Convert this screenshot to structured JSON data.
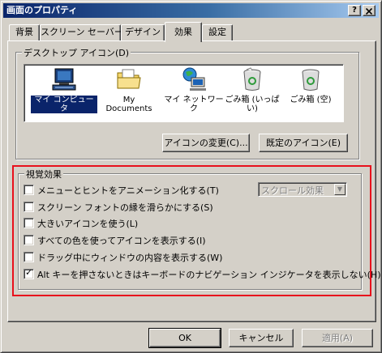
{
  "window": {
    "title": "画面のプロパティ",
    "help_button": "?",
    "close_button": "x"
  },
  "tabs": [
    {
      "label": "背景",
      "active": false
    },
    {
      "label": "スクリーン セーバー",
      "active": false
    },
    {
      "label": "デザイン",
      "active": false
    },
    {
      "label": "効果",
      "active": true
    },
    {
      "label": "設定",
      "active": false
    }
  ],
  "desktop_icons": {
    "group_label": "デスクトップ アイコン(D)",
    "items": [
      {
        "label": "マイ コンピュータ",
        "icon": "my-computer-icon",
        "selected": true
      },
      {
        "label": "My Documents",
        "icon": "my-documents-folder-icon",
        "selected": false
      },
      {
        "label": "マイ ネットワーク",
        "icon": "my-network-icon",
        "selected": false
      },
      {
        "label": "ごみ箱 (いっぱい)",
        "icon": "recycle-bin-full-icon",
        "selected": false
      },
      {
        "label": "ごみ箱 (空)",
        "icon": "recycle-bin-empty-icon",
        "selected": false
      }
    ],
    "change_icon_button": "アイコンの変更(C)...",
    "default_icon_button": "既定のアイコン(E)"
  },
  "visual_effects": {
    "group_label": "視覚効果",
    "options": [
      {
        "label": "メニューとヒントをアニメーション化する(T)",
        "checked": false
      },
      {
        "label": "スクリーン フォントの縁を滑らかにする(S)",
        "checked": false
      },
      {
        "label": "大きいアイコンを使う(L)",
        "checked": false
      },
      {
        "label": "すべての色を使ってアイコンを表示する(I)",
        "checked": false
      },
      {
        "label": "ドラッグ中にウィンドウの内容を表示する(W)",
        "checked": false
      },
      {
        "label": "Alt キーを押さないときはキーボードのナビゲーション インジケータを表示しない(H)",
        "checked": true
      }
    ],
    "effect_select": {
      "value": "スクロール効果",
      "disabled": true
    }
  },
  "footer": {
    "ok_button": "OK",
    "cancel_button": "キャンセル",
    "apply_button": "適用(A)"
  },
  "highlight_color": "#e8101c"
}
